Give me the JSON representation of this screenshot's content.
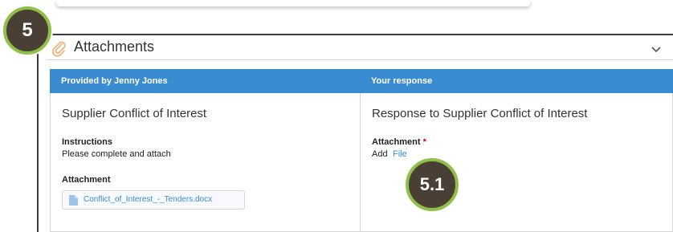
{
  "section": {
    "title": "Attachments",
    "icon": "paperclip-icon",
    "collapse_icon": "chevron-down-icon"
  },
  "table": {
    "left_header": "Provided by Jenny Jones",
    "right_header": "Your response",
    "header_color": "#3a8bd0"
  },
  "left": {
    "title": "Supplier Conflict of Interest",
    "instructions_label": "Instructions",
    "instructions_text": "Please complete and attach",
    "attachment_label": "Attachment",
    "file_name": "Conflict_of_Interest_-_Tenders.docx"
  },
  "right": {
    "title": "Response to Supplier Conflict of Interest",
    "attachment_label": "Attachment",
    "required_mark": "*",
    "add_text": "Add",
    "file_link": "File"
  },
  "badges": {
    "step": "5",
    "substep": "5.1",
    "badge_color": "#4a3f35",
    "ring_color": "#8fc14a"
  }
}
